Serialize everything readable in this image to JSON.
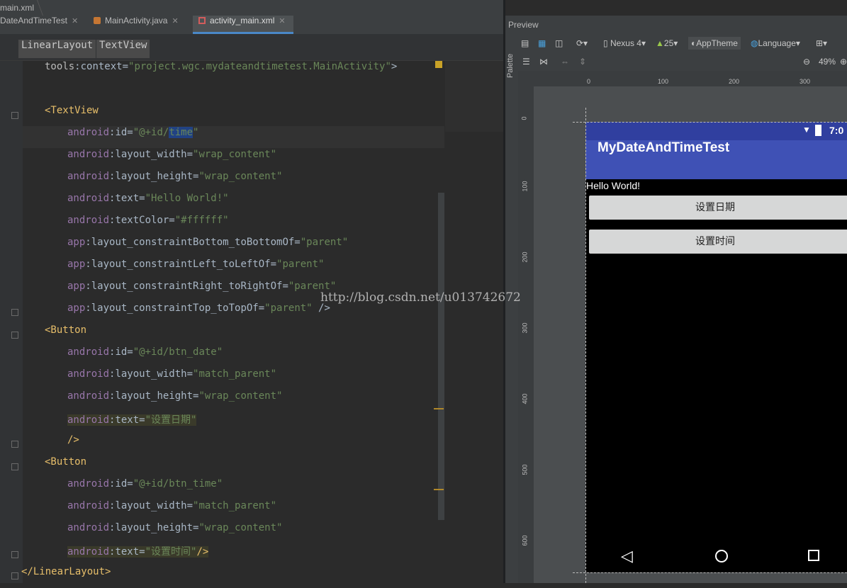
{
  "breadcrumb": {
    "file": "main.xml"
  },
  "tabs": [
    {
      "label": "DateAndTimeTest",
      "active": false
    },
    {
      "label": "MainActivity.java",
      "active": false
    },
    {
      "label": "activity_main.xml",
      "active": true
    }
  ],
  "tag_path": [
    "LinearLayout",
    "TextView"
  ],
  "code_lines": [
    {
      "indent": 1,
      "parts": [
        [
          "a",
          "tools"
        ],
        [
          "c",
          ":context="
        ],
        [
          "v",
          "\"project.wgc.mydateandtimetest.MainActivity\""
        ],
        [
          "c",
          ">"
        ]
      ]
    },
    {
      "indent": 0,
      "parts": []
    },
    {
      "indent": 1,
      "parts": [
        [
          "t",
          "<TextView"
        ]
      ]
    },
    {
      "indent": 2,
      "parts": [
        [
          "k",
          "android"
        ],
        [
          "c",
          ":id="
        ],
        [
          "v",
          "\"@+id/"
        ],
        [
          "s",
          "time"
        ],
        [
          "v",
          "\""
        ]
      ]
    },
    {
      "indent": 2,
      "parts": [
        [
          "k",
          "android"
        ],
        [
          "c",
          ":layout_width="
        ],
        [
          "v",
          "\"wrap_content\""
        ]
      ]
    },
    {
      "indent": 2,
      "parts": [
        [
          "k",
          "android"
        ],
        [
          "c",
          ":layout_height="
        ],
        [
          "v",
          "\"wrap_content\""
        ]
      ]
    },
    {
      "indent": 2,
      "parts": [
        [
          "k",
          "android"
        ],
        [
          "c",
          ":text="
        ],
        [
          "v",
          "\"Hello World!\""
        ]
      ]
    },
    {
      "indent": 2,
      "parts": [
        [
          "k",
          "android"
        ],
        [
          "c",
          ":textColor="
        ],
        [
          "v",
          "\"#ffffff\""
        ]
      ]
    },
    {
      "indent": 2,
      "parts": [
        [
          "k",
          "app"
        ],
        [
          "c",
          ":layout_constraintBottom_toBottomOf="
        ],
        [
          "v",
          "\"parent\""
        ]
      ]
    },
    {
      "indent": 2,
      "parts": [
        [
          "k",
          "app"
        ],
        [
          "c",
          ":layout_constraintLeft_toLeftOf="
        ],
        [
          "v",
          "\"parent\""
        ]
      ]
    },
    {
      "indent": 2,
      "parts": [
        [
          "k",
          "app"
        ],
        [
          "c",
          ":layout_constraintRight_toRightOf="
        ],
        [
          "v",
          "\"parent\""
        ]
      ]
    },
    {
      "indent": 2,
      "parts": [
        [
          "k",
          "app"
        ],
        [
          "c",
          ":layout_constraintTop_toTopOf="
        ],
        [
          "v",
          "\"parent\""
        ],
        [
          "c",
          " />"
        ]
      ]
    },
    {
      "indent": 1,
      "parts": [
        [
          "t",
          "<Button"
        ]
      ]
    },
    {
      "indent": 2,
      "parts": [
        [
          "k",
          "android"
        ],
        [
          "c",
          ":id="
        ],
        [
          "v",
          "\"@+id/btn_date\""
        ]
      ]
    },
    {
      "indent": 2,
      "parts": [
        [
          "k",
          "android"
        ],
        [
          "c",
          ":layout_width="
        ],
        [
          "v",
          "\"match_parent\""
        ]
      ]
    },
    {
      "indent": 2,
      "parts": [
        [
          "k",
          "android"
        ],
        [
          "c",
          ":layout_height="
        ],
        [
          "v",
          "\"wrap_content\""
        ]
      ]
    },
    {
      "indent": 2,
      "hl": true,
      "parts": [
        [
          "k",
          "android"
        ],
        [
          "c",
          ":text="
        ],
        [
          "v",
          "\"设置日期\""
        ]
      ]
    },
    {
      "indent": 2,
      "parts": [
        [
          "t",
          "/>"
        ]
      ]
    },
    {
      "indent": 1,
      "parts": [
        [
          "t",
          "<Button"
        ]
      ]
    },
    {
      "indent": 2,
      "parts": [
        [
          "k",
          "android"
        ],
        [
          "c",
          ":id="
        ],
        [
          "v",
          "\"@+id/btn_time\""
        ]
      ]
    },
    {
      "indent": 2,
      "parts": [
        [
          "k",
          "android"
        ],
        [
          "c",
          ":layout_width="
        ],
        [
          "v",
          "\"match_parent\""
        ]
      ]
    },
    {
      "indent": 2,
      "parts": [
        [
          "k",
          "android"
        ],
        [
          "c",
          ":layout_height="
        ],
        [
          "v",
          "\"wrap_content\""
        ]
      ]
    },
    {
      "indent": 2,
      "hl": true,
      "parts": [
        [
          "k",
          "android"
        ],
        [
          "c",
          ":text="
        ],
        [
          "v",
          "\"设置时间\""
        ],
        [
          "t",
          "/>"
        ]
      ]
    },
    {
      "indent": 0,
      "parts": [
        [
          "t",
          "</LinearLayout>"
        ]
      ]
    }
  ],
  "preview": {
    "title": "Preview",
    "palette_label": "Palette",
    "device": "Nexus 4",
    "api": "25",
    "theme": "AppTheme",
    "language": "Language",
    "zoom": "49%",
    "ruler_top": [
      "0",
      "100",
      "200",
      "300"
    ],
    "ruler_left": [
      "0",
      "100",
      "200",
      "300",
      "400",
      "500",
      "600"
    ],
    "status_time": "7:0",
    "app_title": "MyDateAndTimeTest",
    "hello_text": "Hello World!",
    "btn_date_label": "设置日期",
    "btn_time_label": "设置时间"
  },
  "watermark": "http://blog.csdn.net/u013742672",
  "colors": {
    "accent": "#3f51b5",
    "status": "#303f9f",
    "selection": "#214283"
  }
}
